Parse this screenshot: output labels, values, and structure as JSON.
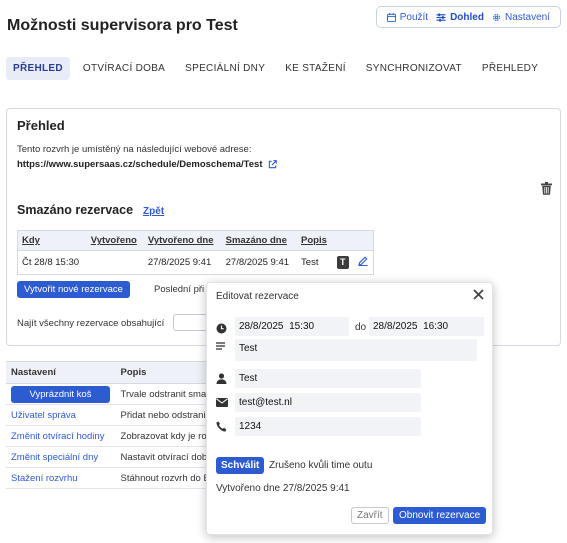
{
  "page": {
    "title": "Možnosti supervisora pro Test"
  },
  "top_actions": [
    {
      "label": "Použít",
      "icon": "calendar-icon"
    },
    {
      "label": "Dohled",
      "icon": "sliders-icon"
    },
    {
      "label": "Nastavení",
      "icon": "gear-icon"
    }
  ],
  "tabs": [
    "PŘEHLED",
    "OTVÍRACÍ DOBA",
    "SPECIÁLNÍ DNY",
    "KE STAŽENÍ",
    "SYNCHRONIZOVAT",
    "PŘEHLEDY"
  ],
  "overview": {
    "title": "Přehled",
    "description": "Tento rozvrh je umístěný na následující webové adrese:",
    "url": "https://www.supersaas.cz/schedule/Demoschema/Test",
    "deleted_title": "Smazáno rezervace",
    "back_link": "Zpět",
    "table": {
      "headers": [
        "Kdy",
        "Vytvořeno",
        "Vytvořeno dne",
        "Smazáno dne",
        "Popis"
      ],
      "rows": [
        {
          "kdy": "Čt 28/8 15:30",
          "vytvoreno": "",
          "vytvoreno_dne": "27/8/2025 9:41",
          "smazano_dne": "27/8/2025 9:41",
          "popis": "Test",
          "tag": "T"
        }
      ]
    },
    "new_button": "Vytvořit nové rezervace",
    "last_label": "Poslední při",
    "find_label": "Najít všechny rezervace obsahující"
  },
  "settings": {
    "headers": [
      "Nastavení",
      "Popis"
    ],
    "rows": [
      {
        "action": "Vyprázdnit koš",
        "desc": "Trvale odstranit sma",
        "button": true
      },
      {
        "action": "Uživatel správa",
        "desc": "Přidat nebo odstrani",
        "button": false
      },
      {
        "action": "Změnit otvírací hodiny",
        "desc": "Zobrazovat kdy je ro",
        "button": false
      },
      {
        "action": "Změnit speciální dny",
        "desc": "Nastavit otvírací dob",
        "button": false
      },
      {
        "action": "Stažení rozvrhu",
        "desc": "Stáhnout rozvrh do E",
        "button": false
      }
    ]
  },
  "dialog": {
    "title": "Editovat rezervace",
    "start_date": "28/8/2025",
    "start_time": "15:30",
    "to_label": "do",
    "end_date": "28/8/2025",
    "end_time": "16:30",
    "description": "Test",
    "name": "Test",
    "email": "test@test.nl",
    "phone": "1234",
    "approve_button": "Schválit",
    "status": "Zrušeno kvůli time outu",
    "created": "Vytvořeno dne 27/8/2025 9:41",
    "close_button": "Zavřít",
    "save_button": "Obnovit rezervace"
  },
  "colors": {
    "accent": "#2d5bd0",
    "active_tab_bg": "#e8ecf7",
    "header_bg": "#eef1f8"
  }
}
